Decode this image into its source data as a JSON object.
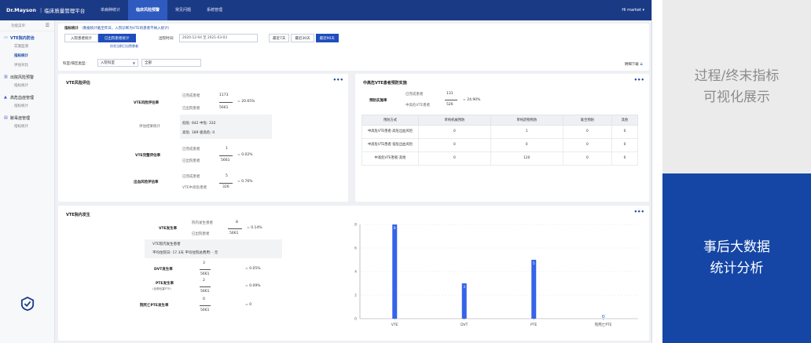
{
  "app": {
    "logo_brand": "Dr.Mayson",
    "logo_title": "临床质量管理平台",
    "nav": [
      "单病种统计",
      "临床风险预警",
      "常见问题",
      "系统管理"
    ],
    "user": "Hi market ▾"
  },
  "sidebar": {
    "header": "功能菜单",
    "groups": [
      {
        "label": "VTE院内防治",
        "icon": "shield-icon",
        "subs": [
          "实施监测",
          "指标统计",
          "评估对比"
        ]
      },
      {
        "label": "出院风险预警",
        "icon": "bar-chart-icon",
        "subs": [
          "指标统计"
        ]
      },
      {
        "label": "高危血症管理",
        "icon": "chart-icon",
        "subs": [
          "指标统计"
        ]
      },
      {
        "label": "脓毒症管理",
        "icon": "list-icon",
        "subs": [
          "指标统计"
        ]
      }
    ]
  },
  "filter": {
    "title": "指标统计",
    "notice": "（数据统计截至昨日，入院诊断为VTE的患者不纳入统计）",
    "tabs": [
      "入院患者统计",
      "已出院患者统计"
    ],
    "hint": "仅含当前已出院患者",
    "time_label": "出院时间:",
    "time_value": "2020-12-04 至 2021-03-03",
    "quick": [
      "最近7天",
      "最近30天",
      "最近90天"
    ],
    "dept_label": "科室/病区类型:",
    "dept_value": "入院科室",
    "dept_all": "全部",
    "download": "明细下载"
  },
  "card1": {
    "title": "VTE风险评估",
    "r1_label": "VTE风险评估率",
    "r1_num_label": "已完成患者",
    "r1_num": "1173",
    "r1_den_label": "已出院患者",
    "r1_den": "5661",
    "r1_pct": "= 20.65%",
    "res_label": "评估结果统计",
    "res_line1": "低危: 642  中危: 332",
    "res_line2": "高危: 189  极高危: 0",
    "r2_label": "VTE完整评估率",
    "r2_num_label": "已完成患者",
    "r2_num": "1",
    "r2_den_label": "已出院患者",
    "r2_den": "5661",
    "r2_pct": "= 0.02%",
    "r3_label": "出血风险评估率",
    "r3_num_label": "已完成患者",
    "r3_num": "5",
    "r3_den_label": "VTE中高危患者",
    "r3_den": "326",
    "r3_pct": "= 0.76%"
  },
  "card2": {
    "title": "中高危VTE患者预防实施",
    "rate_label": "预防实施率",
    "num_label": "已完成患者",
    "num": "131",
    "den_label": "中高危VTE患者",
    "den": "526",
    "pct": "= 24.90%",
    "headers": [
      "预防方式",
      "单纯机械预防",
      "单纯药物预防",
      "联合预防",
      "其他"
    ],
    "rows": [
      [
        "中高危VTE患者-高危出血风险",
        "0",
        "1",
        "0",
        "0"
      ],
      [
        "中高危VTE患者-低危出血风险",
        "0",
        "0",
        "0",
        "0"
      ],
      [
        "中高危VTE患者-其他",
        "0",
        "120",
        "0",
        "0"
      ]
    ]
  },
  "card3": {
    "title": "VTE院内发生",
    "o1_label": "VTE发生率",
    "o1_num_label": "院内发生患者",
    "o1_num": "8",
    "o1_den_label": "已出院患者",
    "o1_den": "5661",
    "o1_pct": "= 0.14%",
    "box_line1": "VTE院内发生患者",
    "box_line2": "平均住院日: 17.3天    平均住院总费用: - 元",
    "o2_label": "DVT发生率",
    "o2_num": "3",
    "o2_den": "5661",
    "o2_pct": "= 0.05%",
    "o3_label": "PTE发生率",
    "o3_sub": "(含肺栓塞PTE)",
    "o3_num": "2",
    "o3_den": "5661",
    "o3_pct": "= 0.09%",
    "o4_label": "院死亡PTE发生率",
    "o4_num": "0",
    "o4_den": "5661",
    "o4_pct": "= 0"
  },
  "chart_data": {
    "type": "bar",
    "categories": [
      "VTE",
      "DVT",
      "PTE",
      "院死亡PTE"
    ],
    "values": [
      8,
      3,
      5,
      0
    ],
    "ylim": [
      0,
      8
    ],
    "yticks": [
      "0",
      "2",
      "4",
      "6",
      "8"
    ],
    "grid": true,
    "bar_color": "#3563e9",
    "title": ""
  },
  "right_panel": {
    "top_line1": "过程/终末指标",
    "top_line2": "可视化展示",
    "bottom_line1": "事后大数据",
    "bottom_line2": "统计分析"
  }
}
